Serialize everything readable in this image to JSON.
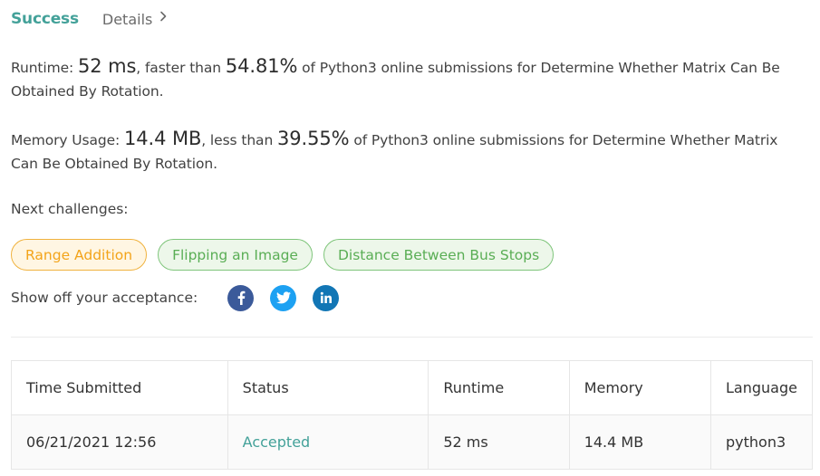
{
  "tabs": {
    "success": "Success",
    "details": "Details"
  },
  "runtime": {
    "label": "Runtime:",
    "value": "52 ms",
    "comparison": ", faster than",
    "percent": "54.81%",
    "suffix": "of Python3 online submissions for Determine Whether Matrix Can Be Obtained By Rotation."
  },
  "memory": {
    "label": "Memory Usage:",
    "value": "14.4 MB",
    "comparison": ", less than",
    "percent": "39.55%",
    "suffix": "of Python3 online submissions for Determine Whether Matrix Can Be Obtained By Rotation."
  },
  "next_challenges": {
    "label": "Next challenges:",
    "items": [
      "Range Addition",
      "Flipping an Image",
      "Distance Between Bus Stops"
    ]
  },
  "share": {
    "label": "Show off your acceptance:",
    "icons": [
      "facebook-icon",
      "twitter-icon",
      "linkedin-icon"
    ]
  },
  "table": {
    "headers": [
      "Time Submitted",
      "Status",
      "Runtime",
      "Memory",
      "Language"
    ],
    "rows": [
      [
        "06/21/2021 12:56",
        "Accepted",
        "52 ms",
        "14.4 MB",
        "python3"
      ]
    ]
  },
  "colors": {
    "accent": "#43a199",
    "orange": "#f3a41a",
    "green": "#5aae55",
    "facebook": "#3b5a9a",
    "twitter": "#1da1f2",
    "linkedin": "#1276b5"
  }
}
